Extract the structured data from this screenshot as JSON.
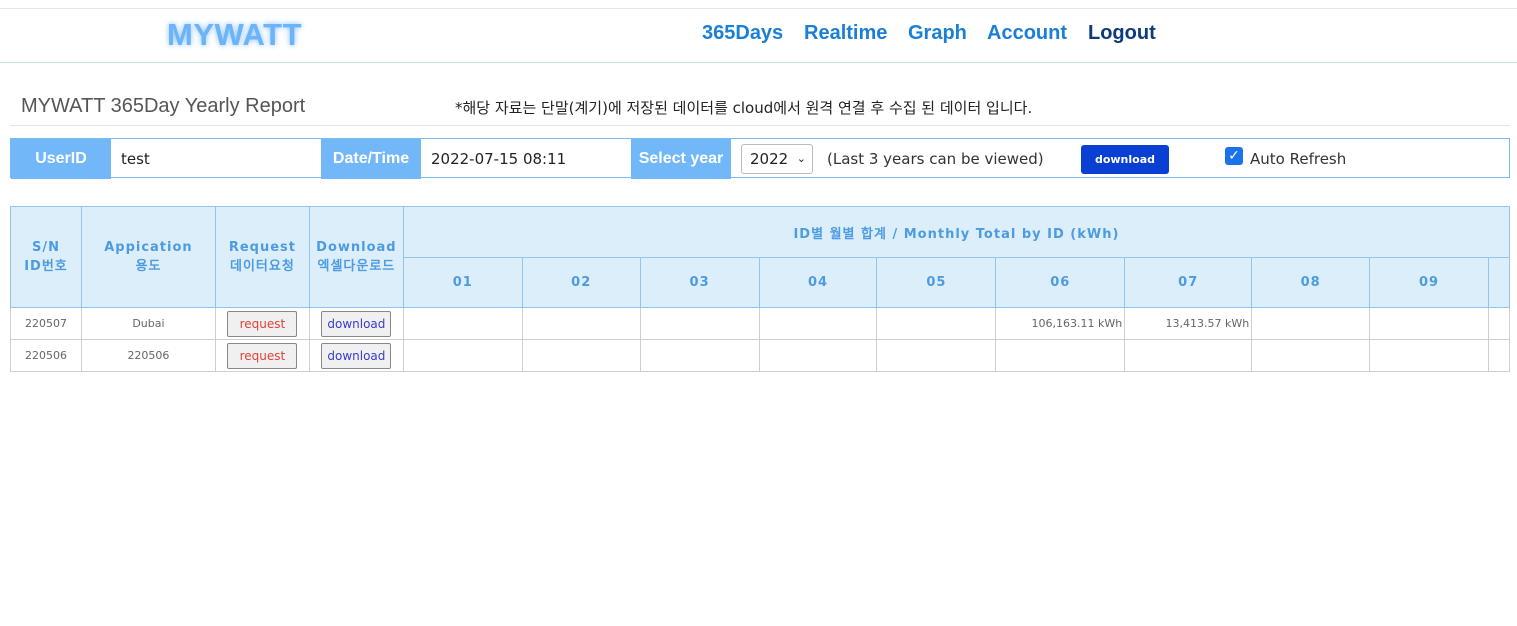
{
  "nav": {
    "logo": "MYWATT",
    "items": [
      "365Days",
      "Realtime",
      "Graph",
      "Account"
    ],
    "logout": "Logout"
  },
  "page": {
    "title": "MYWATT 365Day Yearly Report",
    "notice": "*해당 자료는 단말(계기)에 저장된 데이터를 cloud에서 원격 연결 후 수집 된 데이터 입니다."
  },
  "filter": {
    "userid_label": "UserID",
    "userid_value": "test",
    "datetime_label": "Date/Time",
    "datetime_value": "2022-07-15 08:11",
    "year_label": "Select year",
    "year_value": "2022",
    "year_note": "(Last 3 years can be viewed)",
    "download_label": "download",
    "auto_refresh_label": "Auto Refresh",
    "auto_refresh_checked": true
  },
  "table": {
    "header": {
      "sn_line1": "S/N",
      "sn_line2": "ID번호",
      "app_line1": "Appication",
      "app_line2": "용도",
      "req_line1": "Request",
      "req_line2": "데이터요청",
      "dl_line1": "Download",
      "dl_line2": "엑셀다운로드",
      "monthly": "ID별 월별 합계 / Monthly Total by ID (kWh)",
      "months": [
        "01",
        "02",
        "03",
        "04",
        "05",
        "06",
        "07",
        "08",
        "09"
      ]
    },
    "rows": [
      {
        "sn": "220507",
        "application": "Dubai",
        "request": "request",
        "download": "download",
        "months": [
          "",
          "",
          "",
          "",
          "",
          "106,163.11 kWh",
          "13,413.57 kWh",
          "",
          ""
        ]
      },
      {
        "sn": "220506",
        "application": "220506",
        "request": "request",
        "download": "download",
        "months": [
          "",
          "",
          "",
          "",
          "",
          "",
          "",
          "",
          ""
        ]
      }
    ]
  }
}
